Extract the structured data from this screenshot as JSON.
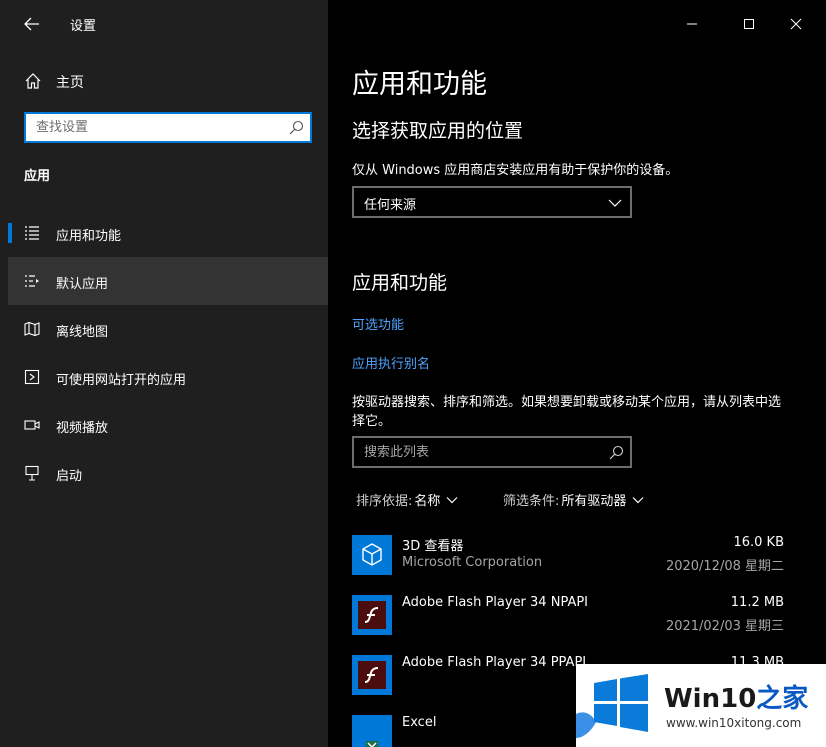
{
  "window": {
    "title": "设置"
  },
  "sidebar": {
    "home_label": "主页",
    "search_placeholder": "查找设置",
    "section_label": "应用",
    "items": [
      {
        "label": "应用和功能",
        "icon": "apps-features-icon",
        "state": "active"
      },
      {
        "label": "默认应用",
        "icon": "default-apps-icon",
        "state": "hover"
      },
      {
        "label": "离线地图",
        "icon": "offline-maps-icon",
        "state": "normal"
      },
      {
        "label": "可使用网站打开的应用",
        "icon": "apps-for-websites-icon",
        "state": "normal"
      },
      {
        "label": "视频播放",
        "icon": "video-playback-icon",
        "state": "normal"
      },
      {
        "label": "启动",
        "icon": "startup-icon",
        "state": "normal"
      }
    ]
  },
  "main": {
    "page_title": "应用和功能",
    "install_section": {
      "heading": "选择获取应用的位置",
      "description": "仅从 Windows 应用商店安装应用有助于保护你的设备。",
      "dropdown_value": "任何来源"
    },
    "apps_section": {
      "heading": "应用和功能",
      "link_optional": "可选功能",
      "link_alias": "应用执行别名",
      "description": "按驱动器搜索、排序和筛选。如果想要卸载或移动某个应用，请从列表中选择它。",
      "search_placeholder": "搜索此列表",
      "sort_key": "排序依据:",
      "sort_value": "名称",
      "filter_key": "筛选条件:",
      "filter_value": "所有驱动器"
    },
    "apps": [
      {
        "name": "3D 查看器",
        "publisher": "Microsoft Corporation",
        "size": "16.0 KB",
        "date": "2020/12/08 星期二",
        "icon": "3d-viewer-icon"
      },
      {
        "name": "Adobe Flash Player 34 NPAPI",
        "publisher": "",
        "size": "11.2 MB",
        "date": "2021/02/03 星期三",
        "icon": "flash-player-icon"
      },
      {
        "name": "Adobe Flash Player 34 PPAPI",
        "publisher": "",
        "size": "11.3 MB",
        "date": "",
        "icon": "flash-player-icon"
      },
      {
        "name": "Excel",
        "publisher": "",
        "size": "",
        "date": "",
        "icon": "excel-icon"
      }
    ]
  },
  "watermark": {
    "title_part1": "Win10",
    "title_part2": "之家",
    "url": "www.win10xitong.com"
  },
  "colors": {
    "accent": "#0078d7",
    "sidebar_bg": "#1f1f1f",
    "main_bg": "#000000",
    "link": "#4ea3ff"
  }
}
